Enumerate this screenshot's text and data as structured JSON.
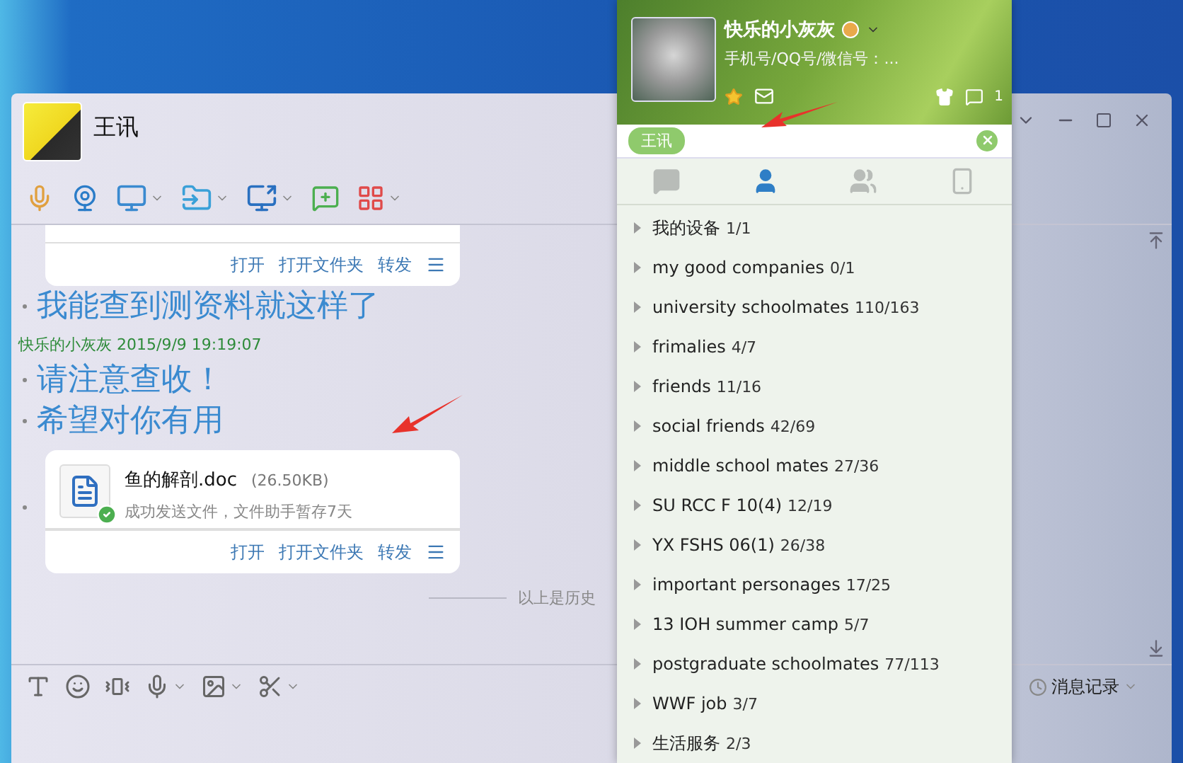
{
  "chat_window": {
    "contact_name": "王讯",
    "messages": [
      {
        "kind": "file_partial",
        "actions": [
          "打开",
          "打开文件夹",
          "转发"
        ]
      },
      {
        "kind": "text",
        "text": "我能查到测资料就这样了"
      },
      {
        "kind": "sender",
        "text": "快乐的小灰灰 2015/9/9 19:19:07"
      },
      {
        "kind": "text",
        "text": "请注意查收！"
      },
      {
        "kind": "text",
        "text": "希望对你有用"
      },
      {
        "kind": "file",
        "file_name": "鱼的解剖.doc",
        "size": "(26.50KB)",
        "status": "成功发送文件，文件助手暂存7天",
        "actions": [
          "打开",
          "打开文件夹",
          "转发"
        ]
      }
    ],
    "history_divider": "以上是历史",
    "history_button": "消息记录"
  },
  "main_panel": {
    "nickname": "快乐的小灰灰",
    "signature": "手机号/QQ号/微信号：...",
    "box_count": "1",
    "search_tag": "王讯",
    "tabs": [
      {
        "kind": "recent",
        "selected": false
      },
      {
        "kind": "contacts",
        "selected": true
      },
      {
        "kind": "groups",
        "selected": false
      },
      {
        "kind": "devices",
        "selected": false
      }
    ],
    "groups": [
      {
        "name": "我的设备",
        "count": "1/1"
      },
      {
        "name": "my good companies",
        "count": "0/1"
      },
      {
        "name": "university schoolmates",
        "count": "110/163"
      },
      {
        "name": "frimalies",
        "count": "4/7"
      },
      {
        "name": "friends",
        "count": "11/16"
      },
      {
        "name": "social friends",
        "count": "42/69"
      },
      {
        "name": "middle school mates",
        "count": "27/36"
      },
      {
        "name": "SU RCC F 10(4)",
        "count": "12/19"
      },
      {
        "name": "YX FSHS 06(1)",
        "count": "26/38"
      },
      {
        "name": "important personages",
        "count": "17/25"
      },
      {
        "name": "13 IOH summer camp",
        "count": "5/7"
      },
      {
        "name": "postgraduate schoolmates",
        "count": "77/113"
      },
      {
        "name": "WWF job",
        "count": "3/7"
      },
      {
        "name": "生活服务",
        "count": "2/3"
      }
    ]
  }
}
